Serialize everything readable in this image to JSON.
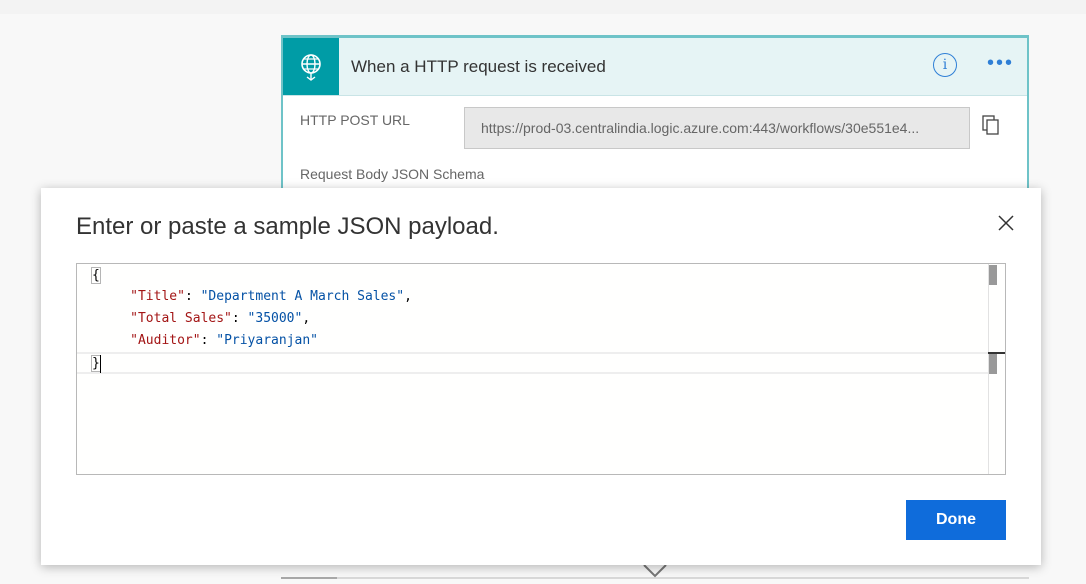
{
  "trigger_card": {
    "title": "When a HTTP request is received",
    "icon": "globe-request-icon",
    "http_post_url_label": "HTTP POST URL",
    "http_post_url_value": "https://prod-03.centralindia.logic.azure.com:443/workflows/30e551e4...",
    "request_body_schema_label": "Request Body JSON Schema",
    "accent_color": "#009ca6"
  },
  "modal": {
    "title": "Enter or paste a sample JSON payload.",
    "json_lines": {
      "open_brace": "{",
      "key1": "\"Title\"",
      "val1": "\"Department A March Sales\"",
      "key2": "\"Total Sales\"",
      "val2": "\"35000\"",
      "key3": "\"Auditor\"",
      "val3": "\"Priyaranjan\"",
      "close_brace": "}",
      "colon": ": ",
      "comma": ","
    },
    "done_label": "Done",
    "button_color": "#0f6cdb"
  }
}
